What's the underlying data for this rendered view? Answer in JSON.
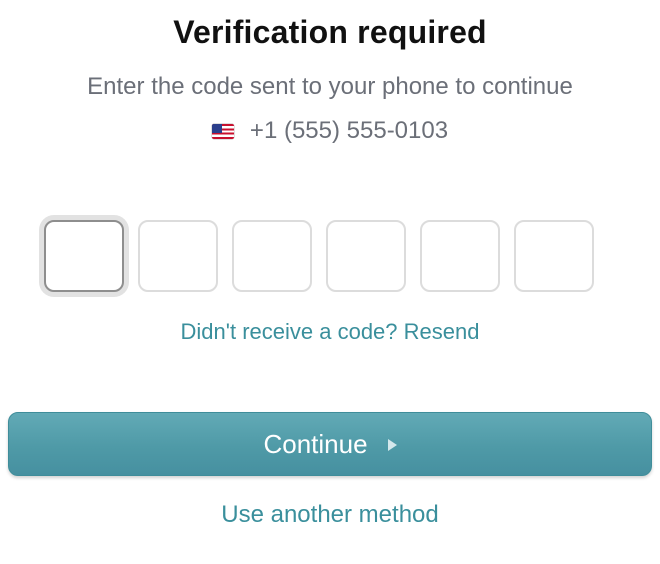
{
  "header": {
    "title": "Verification required",
    "subtitle": "Enter the code sent to your phone to continue"
  },
  "phone": {
    "flag_icon": "us-flag-icon",
    "number": "+1 (555) 555-0103"
  },
  "code_inputs": [
    {
      "value": "",
      "focused": true
    },
    {
      "value": ""
    },
    {
      "value": ""
    },
    {
      "value": ""
    },
    {
      "value": ""
    },
    {
      "value": ""
    }
  ],
  "resend": {
    "label": "Didn't receive a code? Resend"
  },
  "continue_button": {
    "label": "Continue",
    "icon": "play-arrow-icon"
  },
  "alternate": {
    "label": "Use another method"
  },
  "colors": {
    "accent": "#4f9aa7",
    "link": "#3a8f9c",
    "title": "#111111",
    "muted": "#6b6f78"
  }
}
